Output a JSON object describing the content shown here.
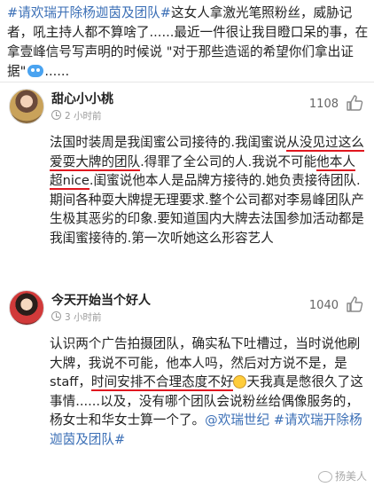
{
  "post": {
    "hashtag": "#请欢瑞开除杨迦茵及团队#",
    "body": "这女人拿激光笔照粉丝，威胁记者，吼主持人都不算啥了......最近一件很让我目瞪口呆的事，在拿壹峰信号写声明的时候说 \"对于那些造谣的希望你们拿出证据\"",
    "ellipsis": "......"
  },
  "comments": [
    {
      "username": "甜心小小桃",
      "time": "2 小时前",
      "likes": "1108",
      "text_before_u1": "法国时装周是我闺蜜公司接待的.我闺蜜说",
      "u1": "从没见过这么爱耍大牌的团队",
      "text_mid": ".得罪了全公司的人.我说不可能",
      "u2": "他本人超nice",
      "text_after_u2": ".闺蜜说他本人是品牌方接待的.她负责接待团队.期间各种耍大牌提无理要求.整个公司都对李易峰团队产生极其恶劣的印象.要知道国内大牌去法国参加活动都是我闺蜜接待的.第一次听她这么形容艺人"
    },
    {
      "username": "今天开始当个好人",
      "time": "3 小时前",
      "likes": "1040",
      "text_before_u1": "认识两个广告拍摄团队，确实私下吐槽过，当时说他刷大牌，我说不可能，他本人吗，然后对方说不是，是staff，",
      "u1": "时间安排不合理态度不好",
      "text_after_u1": "天我真是憋很久了这事情......以及，没有哪个团队会说粉丝给偶像服务的，杨女士和华女士算一个了。",
      "mention": "@欢瑞世纪",
      "hashtag": "#请欢瑞开除杨迦茵及团队#"
    }
  ],
  "watermark": "扬美人",
  "colors": {
    "link": "#3b6fb6",
    "underline": "#e0161f",
    "text": "#222222"
  }
}
